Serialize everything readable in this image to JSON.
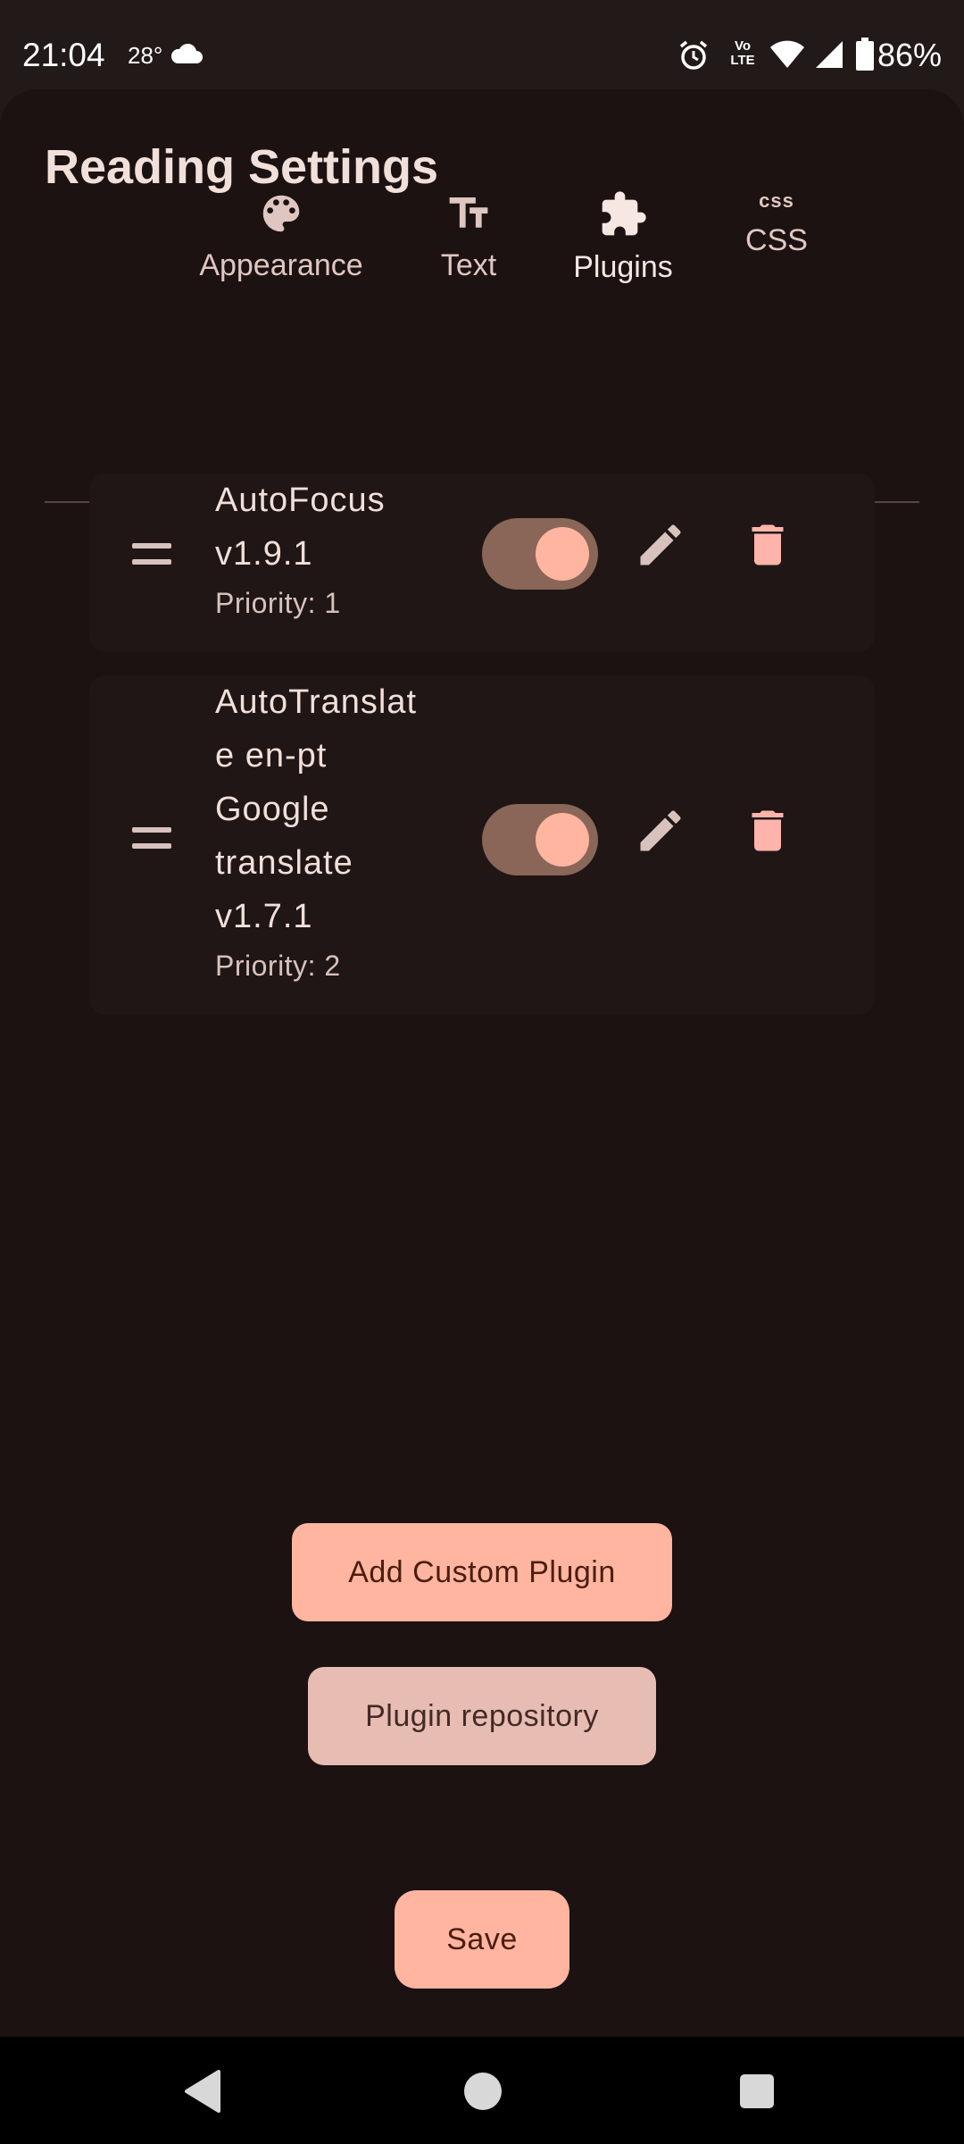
{
  "status_bar": {
    "time": "21:04",
    "temperature": "28°",
    "weather_icon": "cloud-icon",
    "alarm_icon": "alarm-icon",
    "volte_label": "Vo\nLTE",
    "wifi_icon": "wifi-icon",
    "signal_icon": "signal-icon",
    "battery_percent": "86%"
  },
  "header": {
    "title": "Reading Settings"
  },
  "tabs": [
    {
      "label": "Appearance",
      "icon": "palette-icon",
      "active": false
    },
    {
      "label": "Text",
      "icon": "text-size-icon",
      "active": false
    },
    {
      "label": "Plugins",
      "icon": "puzzle-icon",
      "active": true
    },
    {
      "label": "CSS",
      "icon": "css-icon",
      "icon_text": "css",
      "active": false
    }
  ],
  "plugins": [
    {
      "name_lines": [
        "AutoFocus",
        "v1.9.1"
      ],
      "priority": "Priority: 1",
      "enabled": true
    },
    {
      "name_lines": [
        "AutoTranslat",
        "e en-pt",
        "Google",
        "translate",
        "v1.7.1"
      ],
      "priority": "Priority: 2",
      "enabled": true
    }
  ],
  "actions": {
    "add_custom_plugin": "Add Custom Plugin",
    "plugin_repository": "Plugin repository",
    "save": "Save"
  },
  "colors": {
    "background": "#1b1211",
    "accent": "#ffb59f",
    "secondary_container": "#e7bdb3",
    "delete_icon": "#ffb4ab",
    "toggle_track": "#8a6658"
  }
}
